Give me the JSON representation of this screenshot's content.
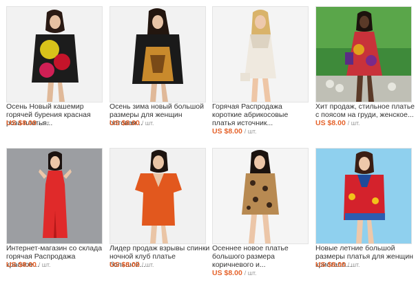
{
  "products": [
    {
      "title": "Осень Новый кашемир горячей бурения красная роза платья...",
      "price": "US $8.00",
      "unit": "/ шт.",
      "image": "woman-floral-sweater-dress"
    },
    {
      "title": "Осень зима новый большой размеры для женщин оптовая...",
      "price": "US $8.00",
      "unit": "/ шт.",
      "image": "woman-tiger-print-sweater"
    },
    {
      "title": "Горячая Распродажа короткие абрикосовые платья источник...",
      "price": "US $8.00",
      "unit": "/ шт.",
      "image": "woman-white-lace-dress"
    },
    {
      "title": "Хит продаж, стильное платье с поясом на груди, женское...",
      "price": "US $8.00",
      "unit": "/ шт.",
      "image": "woman-printed-summer-dress"
    },
    {
      "title": "Интернет-магазин со склада горячая Распродажа красное...",
      "price": "US $8.00",
      "unit": "/ шт.",
      "image": "woman-red-maxi-dress"
    },
    {
      "title": "Лидер продаж взрывы спинки ночной клуб платье большой...",
      "price": "US $8.00",
      "unit": "/ шт.",
      "image": "woman-orange-dress"
    },
    {
      "title": "Осеннее новое платье большого размера коричневого и...",
      "price": "US $8.00",
      "unit": "/ шт.",
      "image": "woman-leopard-dress"
    },
    {
      "title": "Новые летние большой размеры платья для женщин кристалл...",
      "price": "US $8.00",
      "unit": "/ шт.",
      "image": "woman-red-floral-tunic"
    }
  ]
}
